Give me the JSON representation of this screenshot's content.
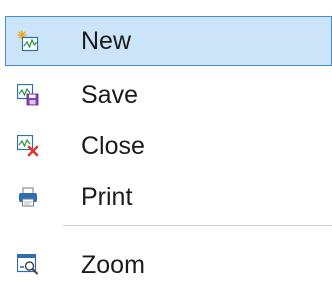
{
  "menu": {
    "items": [
      {
        "label": "New",
        "icon": "new-chart-icon",
        "selected": true
      },
      {
        "label": "Save",
        "icon": "save-chart-icon",
        "selected": false
      },
      {
        "label": "Close",
        "icon": "close-chart-icon",
        "selected": false
      },
      {
        "label": "Print",
        "icon": "print-icon",
        "selected": false
      },
      {
        "label": "Zoom",
        "icon": "zoom-icon",
        "selected": false
      }
    ]
  },
  "colors": {
    "selection_background": "#cce4f7",
    "selection_border": "#3d8ee6",
    "text": "#1b1b1b",
    "separator": "#cfcfcf",
    "icon_red": "#e0362c",
    "icon_blue": "#2d6fb0"
  }
}
